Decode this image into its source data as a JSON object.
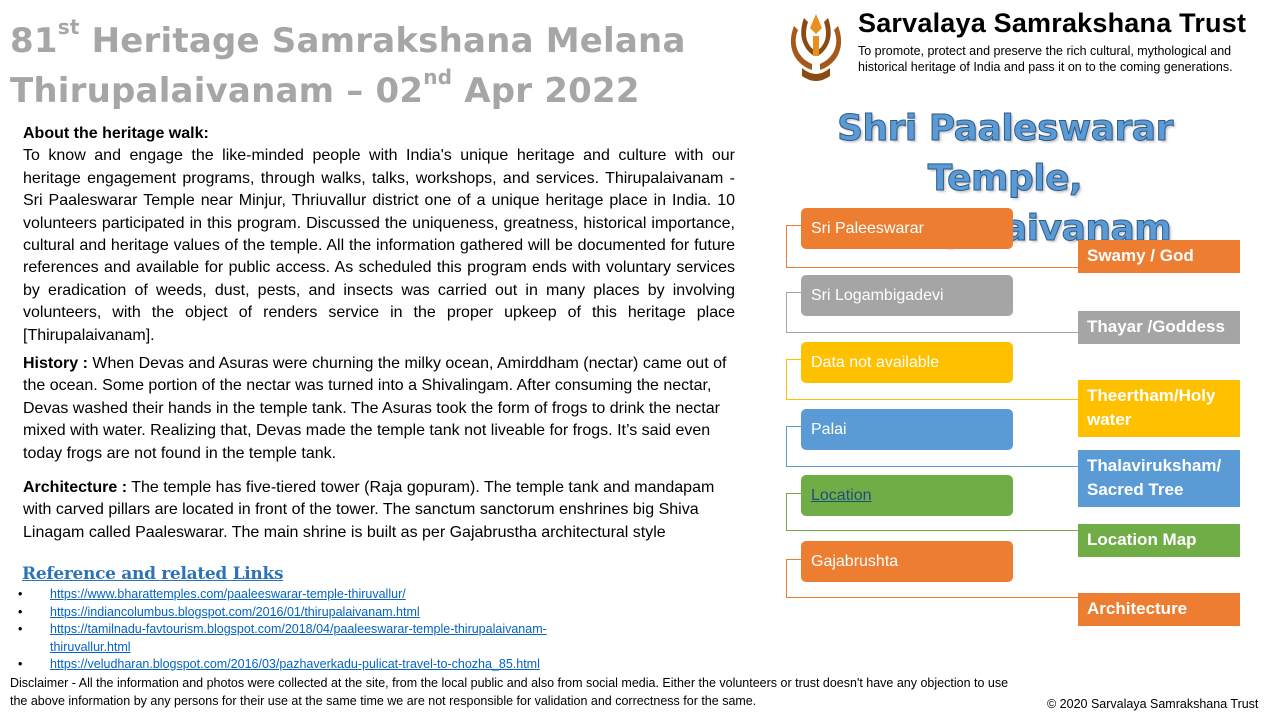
{
  "title": {
    "line1_num": "81",
    "line1_sup": "st",
    "line1_rest": " Heritage Samrakshana Melana",
    "line2_main": "Thirupalaivanam – 02",
    "line2_sup": "nd",
    "line2_rest": " Apr 2022"
  },
  "about": {
    "heading": "About the heritage walk:",
    "text": "To know and engage the like-minded people with India's unique heritage and culture with our heritage engagement programs, through walks, talks, workshops, and services. Thirupalaivanam -Sri Paaleswarar Temple near Minjur, Thriuvallur district one of a unique heritage place in India. 10 volunteers participated in this program. Discussed the uniqueness, greatness, historical importance, cultural and heritage values of the temple. All the information gathered will be documented for future references and available for public access. As scheduled this program ends with voluntary services by eradication of weeds, dust, pests, and insects was carried out in many places by involving volunteers, with the object of renders service in the proper upkeep of this heritage place [Thirupalaivanam]."
  },
  "history": {
    "label": "History :",
    "text": " When Devas and Asuras were churning the milky ocean, Amirddham (nectar) came out of the ocean. Some portion of the nectar was turned into a Shivalingam. After consuming the nectar, Devas washed their hands in the temple tank. The Asuras took the form of frogs to drink the nectar mixed with water. Realizing that, Devas made the temple tank not liveable for frogs. It’s said even today frogs are not found in the temple tank."
  },
  "architecture": {
    "label": "Architecture :",
    "text": " The temple has five-tiered tower (Raja gopuram). The temple tank and mandapam with carved pillars are located in front of the tower. The sanctum sanctorum enshrines big Shiva Linagam called Paaleswarar. The main shrine is built as per Gajabrustha architectural style"
  },
  "references": {
    "heading": "Reference and related Links",
    "links": [
      "https://www.bharattemples.com/paaleeswarar-temple-thiruvallur/",
      "https://indiancolumbus.blogspot.com/2016/01/thirupalaivanam.html",
      "https://tamilnadu-favtourism.blogspot.com/2018/04/paaleeswarar-temple-thirupalaivanam-thiruvallur.html",
      "https://veludharan.blogspot.com/2016/03/pazhaverkadu-pulicat-travel-to-chozha_85.html"
    ]
  },
  "disclaimer": "Disclaimer - All the information and photos were collected at the site, from the local public and also from social media. Either the volunteers or trust doesn't have any objection to use the above information by any persons for their use at the same time we are not responsible for validation and correctness for the same.",
  "copyright": "© 2020  Sarvalaya Samrakshana Trust",
  "trust": {
    "name": "Sarvalaya Samrakshana Trust",
    "tagline": "To promote, protect and preserve the rich cultural, mythological and historical heritage of India and pass it on to the coming generations."
  },
  "temple_title": {
    "line1": "Shri Paaleswarar Temple,",
    "line2": "Thirupalaivanam"
  },
  "info": [
    {
      "value": "Sri Paleeswarar",
      "tag": "Swamy / God",
      "color": "#ed7d31"
    },
    {
      "value": "Sri Logambigadevi",
      "tag": "Thayar /Goddess",
      "color": "#a5a5a5"
    },
    {
      "value": "Data not available",
      "tag": "Theertham/Holy water",
      "color": "#ffc000"
    },
    {
      "value": "Palai",
      "tag": "Thalaviruksham/ Sacred Tree",
      "color": "#5b9bd5"
    },
    {
      "value": "Location",
      "tag": "Location Map",
      "color": "#70ad47"
    },
    {
      "value": "Gajabrushta",
      "tag": "Architecture",
      "color": "#ed7d31"
    }
  ]
}
